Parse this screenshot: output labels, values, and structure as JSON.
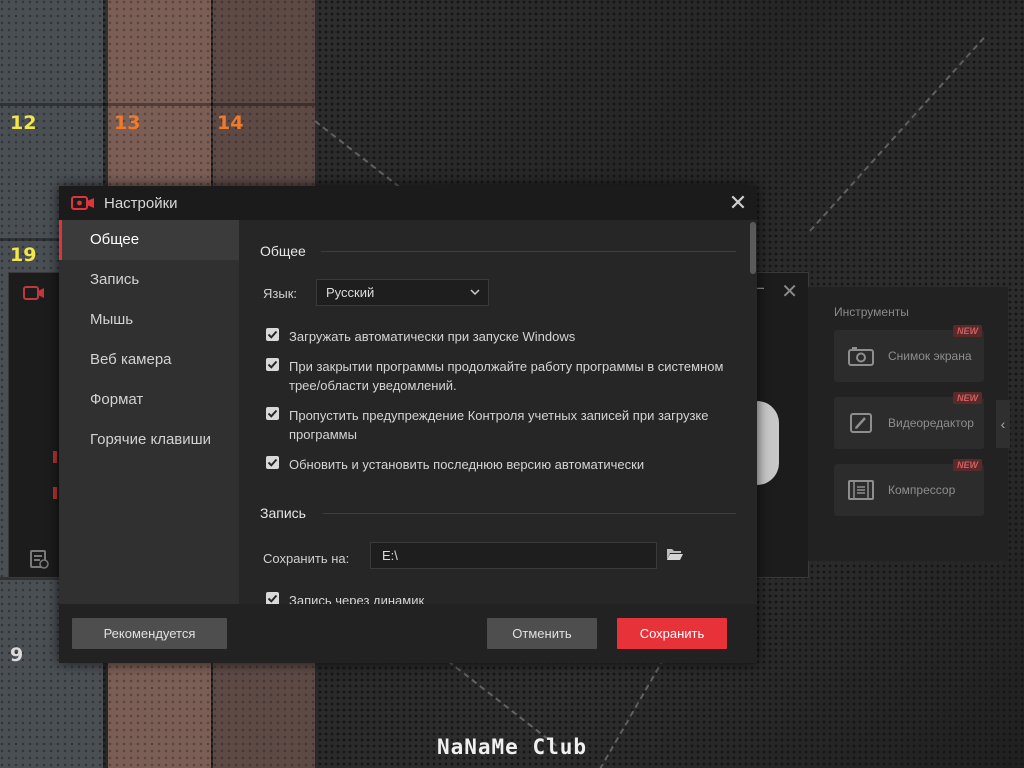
{
  "desktop": {
    "tile_numbers": [
      "12",
      "13",
      "14",
      "19",
      "9"
    ],
    "watermark": "NaNaMe Club"
  },
  "background_app": {
    "tools_title": "Инструменты",
    "tools": [
      {
        "icon": "camera-icon",
        "label": "Снимок экрана",
        "badge": "NEW"
      },
      {
        "icon": "video-editor-icon",
        "label": "Видеоредактор",
        "badge": "NEW"
      },
      {
        "icon": "compressor-icon",
        "label": "Компрессор",
        "badge": "NEW"
      }
    ]
  },
  "dialog": {
    "title": "Настройки",
    "sidebar": {
      "items": [
        {
          "label": "Общее",
          "active": true
        },
        {
          "label": "Запись",
          "active": false
        },
        {
          "label": "Мышь",
          "active": false
        },
        {
          "label": "Веб камера",
          "active": false
        },
        {
          "label": "Формат",
          "active": false
        },
        {
          "label": "Горячие клавиши",
          "active": false
        }
      ]
    },
    "general": {
      "section_title": "Общее",
      "language_label": "Язык:",
      "language_value": "Русский",
      "checkboxes": [
        {
          "label": "Загружать автоматически при запуске Windows",
          "checked": true
        },
        {
          "label": "При закрытии программы продолжайте работу программы в системном трее/области уведомлений.",
          "checked": true
        },
        {
          "label": "Пропустить предупреждение Контроля учетных записей при загрузке программы",
          "checked": true
        },
        {
          "label": "Обновить и установить последнюю версию автоматически",
          "checked": true
        }
      ]
    },
    "record": {
      "section_title": "Запись",
      "save_to_label": "Сохранить на:",
      "save_to_value": "E:\\",
      "speaker_checkbox": {
        "label": "Запись через динамик",
        "checked": true
      }
    },
    "footer": {
      "recommend_label": "Рекомендуется",
      "cancel_label": "Отменить",
      "save_label": "Сохранить"
    },
    "colors": {
      "accent": "#e8323a",
      "title_bar": "#1b1b1b",
      "sidebar": "#303030",
      "content": "#262626"
    }
  }
}
